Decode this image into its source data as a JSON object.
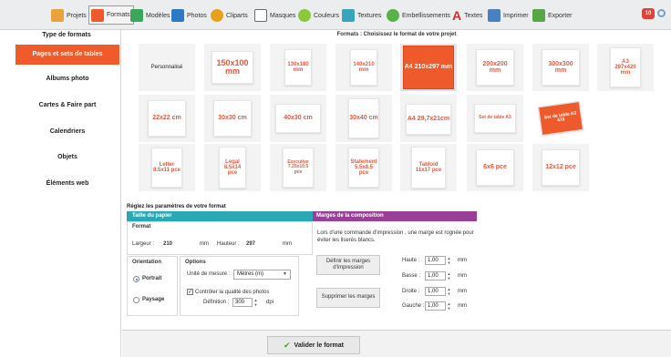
{
  "toolbar": {
    "items": [
      {
        "label": "Projets",
        "icon": "folder-icon",
        "color": "#e8a33d"
      },
      {
        "label": "Formats",
        "icon": "formats-icon",
        "color": "#ef5a2d"
      },
      {
        "label": "Modèles",
        "icon": "templates-icon",
        "color": "#3aa85a"
      },
      {
        "label": "Photos",
        "icon": "photos-icon",
        "color": "#2f78c4"
      },
      {
        "label": "Cliparts",
        "icon": "cliparts-icon",
        "color": "#e6a21e"
      },
      {
        "label": "Masques",
        "icon": "masks-icon",
        "color": "#6b6b6b"
      },
      {
        "label": "Couleurs",
        "icon": "colors-icon",
        "color": "#8dc63f"
      },
      {
        "label": "Textures",
        "icon": "textures-icon",
        "color": "#3aa5b8"
      },
      {
        "label": "Embellissements",
        "icon": "embellishments-icon",
        "color": "#5bb04a"
      },
      {
        "label": "Textes",
        "icon": "text-icon",
        "color": "#c8312c"
      },
      {
        "label": "Imprimer",
        "icon": "print-icon",
        "color": "#4a7fc1"
      },
      {
        "label": "Exporter",
        "icon": "export-icon",
        "color": "#5aa548"
      }
    ],
    "badge": "10"
  },
  "left_panel": {
    "title": "Type de formats",
    "items": [
      "Pages et sets de tables",
      "Albums photo",
      "Cartes & Faire part",
      "Calendriers",
      "Objets",
      "Éléments web"
    ],
    "active_index": 0
  },
  "formats": {
    "title": "Formats : Choisissez le format de votre projet",
    "tiles": [
      [
        "Personnalisé",
        "150x100 mm",
        "130x180 mm",
        "140x210 mm",
        "A4 210x297 mm",
        "200x200 mm",
        "300x300 mm",
        "A3 297x420 mm"
      ],
      [
        "22x22 cm",
        "30x30 cm",
        "40x30 cm",
        "30x40 cm",
        "A4 29,7x21cm",
        "Set de table A3",
        "Set de table A3 479"
      ],
      [
        "Letter 8.5x11 pce",
        "Legal 8.5x14 pce",
        "Executive 7.25x10.5 pce",
        "Statement 5.5x8.5 pce",
        "Tabloid 11x17 pce",
        "6x6 pce",
        "12x12 pce"
      ]
    ],
    "selected": "A4 210x297 mm"
  },
  "params": {
    "title": "Réglez les paramètres de votre format",
    "size_header": "Taille du papier",
    "margins_header": "Marges de la composition",
    "format_label": "Format",
    "width_label": "Largeur :",
    "width_value": "210",
    "width_unit": "mm",
    "height_label": "Hauteur :",
    "height_value": "297",
    "height_unit": "mm",
    "orientation_label": "Orientation",
    "portrait": "Portrait",
    "landscape": "Paysage",
    "orientation_selected": "Portrait",
    "options_label": "Options",
    "unit_label": "Unité de mesure :",
    "unit_value": "Mètres (m)",
    "quality_label": "Contrôler la qualité des photos",
    "quality_checked": true,
    "definition_label": "Définition :",
    "definition_value": "300",
    "dpi": "dpi",
    "margins_info": "Lors d'une commande d'impression , une marge est rognée pour éviter les liserés blancs.",
    "set_margins_button": "Définir les marges d'impression",
    "remove_margins_button": "Supprimer les marges",
    "top_label": "Haute :",
    "bottom_label": "Basse :",
    "right_label": "Droite :",
    "left_label": "Gauche :",
    "margin_value": "1,00",
    "margin_unit": "mm"
  },
  "validate_button": "Valider le format"
}
